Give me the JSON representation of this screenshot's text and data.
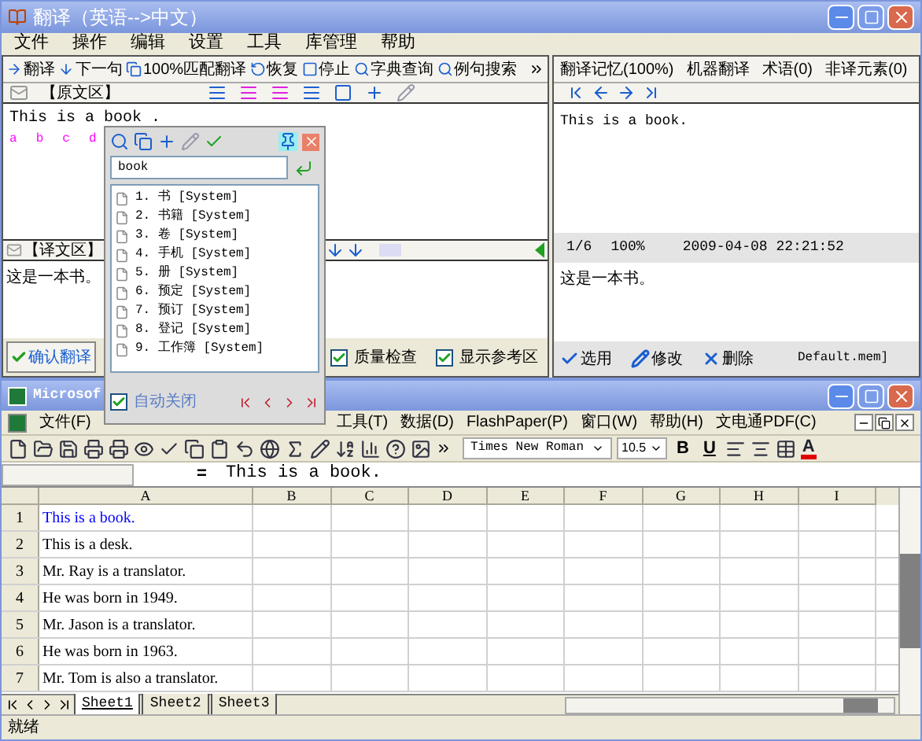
{
  "translator": {
    "title": "翻译（英语-->中文）",
    "menu": [
      "文件",
      "操作",
      "编辑",
      "设置",
      "工具",
      "库管理",
      "帮助"
    ],
    "toolbar": [
      "翻译",
      "下一句",
      "100%匹配翻译",
      "恢复",
      "停止",
      "字典查询",
      "例句搜索"
    ],
    "source": {
      "header": "【原文区】",
      "text": "This is a book .",
      "markers": [
        "a",
        "b",
        "c",
        "d"
      ]
    },
    "target": {
      "header": "【译文区】",
      "text": "这是一本书。"
    },
    "confirm_button": "确认翻译",
    "checks": [
      {
        "label": "质量检查",
        "checked": true
      },
      {
        "label": "显示参考区",
        "checked": true
      }
    ],
    "reference": {
      "tabs": [
        "翻译记忆(100%)",
        "机器翻译",
        "术语(0)",
        "非译元素(0)"
      ],
      "source": "This is a book.",
      "info": [
        "1/6",
        "100%",
        "2009-04-08 22:21:52"
      ],
      "target": "这是一本书。",
      "actions": [
        "选用",
        "修改",
        "删除"
      ],
      "file": "Default.mem]"
    }
  },
  "lookup_popup": {
    "query": "book",
    "results": [
      "1. 书 [System]",
      "2. 书籍 [System]",
      "3. 卷 [System]",
      "4. 手机 [System]",
      "5. 册 [System]",
      "6. 预定 [System]",
      "7. 预订 [System]",
      "8. 登记 [System]",
      "9. 工作簿 [System]"
    ],
    "auto_close": {
      "label": "自动关闭",
      "checked": true
    }
  },
  "excel": {
    "title": "Microsof",
    "menu_left": [
      "文件(F)"
    ],
    "menu_right": [
      "工具(T)",
      "数据(D)",
      "FlashPaper(P)",
      "窗口(W)",
      "帮助(H)",
      "文电通PDF(C)"
    ],
    "font": "Times New Roman",
    "size": "10.5",
    "format": [
      "B",
      "U"
    ],
    "font_color": "A",
    "formula_sign": "=",
    "formula": "This is a book.",
    "columns": [
      "A",
      "B",
      "C",
      "D",
      "E",
      "F",
      "G",
      "H",
      "I"
    ],
    "rows": [
      {
        "number": "1",
        "text": "This is a book.",
        "color": "#0000ff"
      },
      {
        "number": "2",
        "text": "This is a desk.",
        "color": "#000000"
      },
      {
        "number": "3",
        "text": "Mr. Ray is a translator.",
        "color": "#000000"
      },
      {
        "number": "4",
        "text": "He was born in 1949.",
        "color": "#000000"
      },
      {
        "number": "5",
        "text": "Mr. Jason is a translator.",
        "color": "#000000"
      },
      {
        "number": "6",
        "text": "He was born in 1963.",
        "color": "#000000"
      },
      {
        "number": "7",
        "text": "Mr. Tom is also a translator.",
        "color": "#000000"
      }
    ],
    "sheets": [
      {
        "label": "Sheet1",
        "selected": true
      },
      {
        "label": "Sheet2",
        "selected": false
      },
      {
        "label": "Sheet3",
        "selected": false
      }
    ],
    "status": "就绪"
  }
}
